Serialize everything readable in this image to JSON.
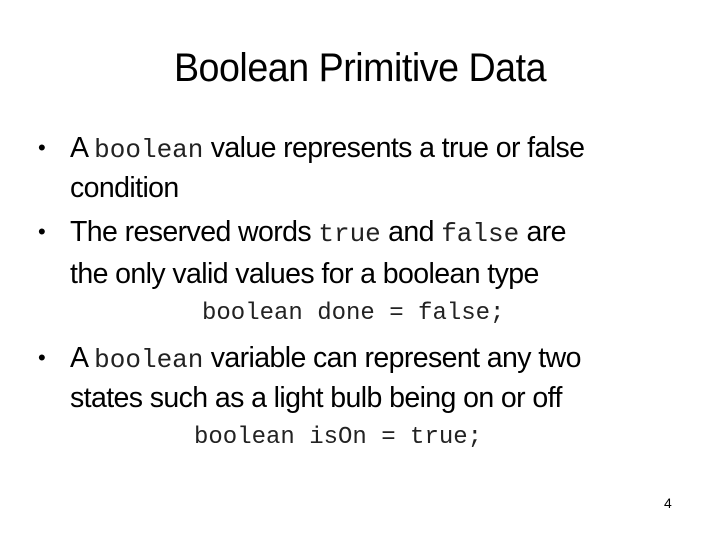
{
  "slide": {
    "title": "Boolean Primitive Data",
    "page_number": "4",
    "bullets": [
      {
        "marker": "•",
        "line1": {
          "pre": "A ",
          "code1": "boolean",
          "post": " value represents a true or false"
        },
        "line2": "condition"
      },
      {
        "marker": "•",
        "line1": {
          "pre": "The reserved words ",
          "code1": "true",
          "mid": " and ",
          "code2": "false",
          "post": " are"
        },
        "line2": "the only valid values for a boolean type",
        "code_example": "boolean done = false;"
      },
      {
        "marker": "•",
        "line1": {
          "pre": "A ",
          "code1": "boolean",
          "post": " variable can represent any two"
        },
        "line2": "states such as a light bulb being on or off",
        "code_example": "boolean isOn = true;"
      }
    ]
  }
}
